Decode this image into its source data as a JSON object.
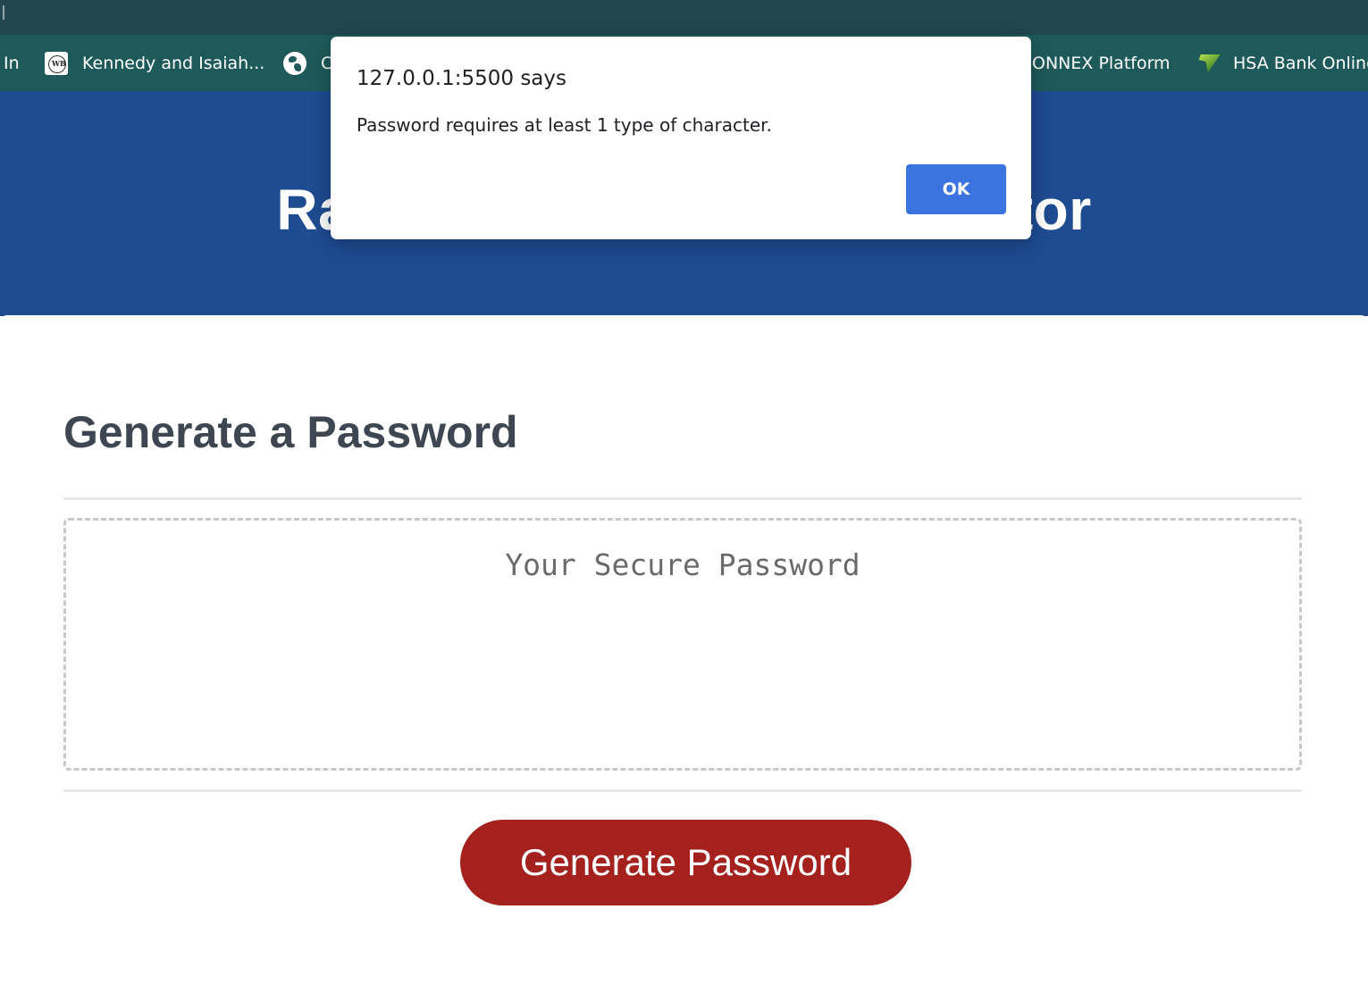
{
  "browser": {
    "bookmarks": [
      {
        "label": "In",
        "icon": "none"
      },
      {
        "label": "Kennedy and Isaiah...",
        "icon": "wb-logo-icon"
      },
      {
        "label": "C",
        "icon": "globe-icon"
      },
      {
        "label": "ONNEX Platform",
        "icon": "none"
      },
      {
        "label": "HSA Bank Online",
        "icon": "hsa-bank-icon"
      }
    ]
  },
  "header": {
    "title": "Random Password Generator"
  },
  "card": {
    "title": "Generate a Password",
    "password_placeholder": "Your Secure Password",
    "password_value": "",
    "generate_label": "Generate Password"
  },
  "dialog": {
    "origin": "127.0.0.1:5500 says",
    "message": "Password requires at least 1 type of character.",
    "ok_label": "OK"
  },
  "colors": {
    "header_bg": "#1e4b91",
    "button_bg": "#a4211d",
    "ok_button_bg": "#3b74e0",
    "bookmarks_bg": "#1f5a5a"
  }
}
